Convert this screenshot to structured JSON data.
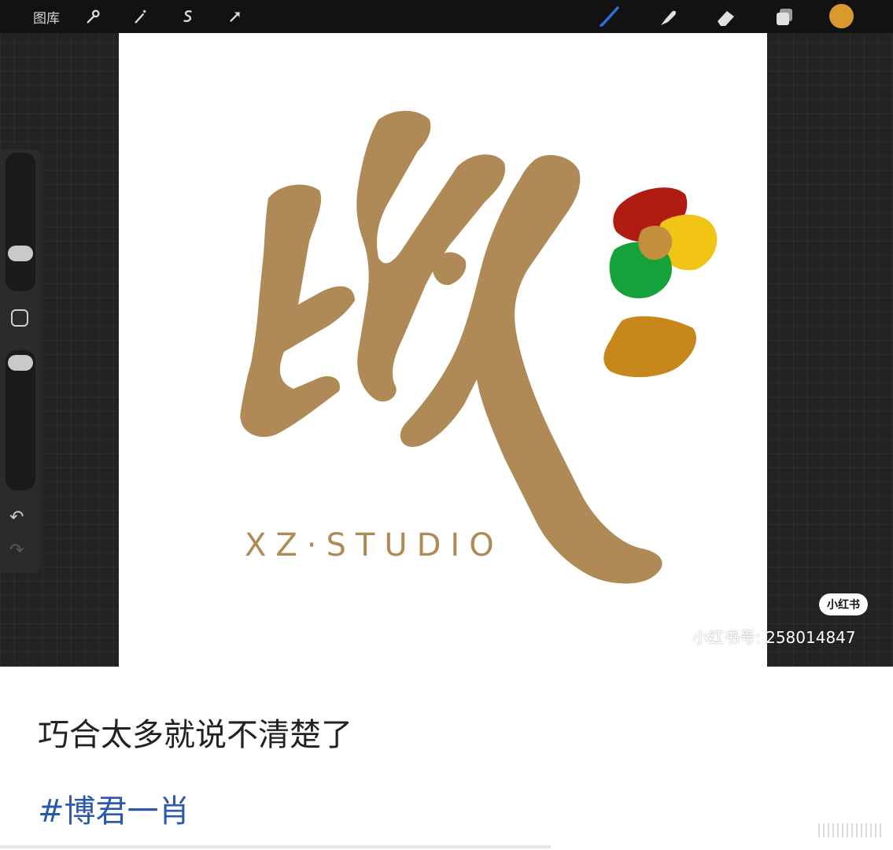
{
  "app": {
    "gallery_label": "图库",
    "colors": {
      "topbar_bg": "#121212",
      "canvas_bg": "#ffffff",
      "current_color": "#d89a2c",
      "brush_active": "#2f6fd6"
    },
    "left_tools": [
      "wrench-icon",
      "magic-wand-icon",
      "selection-icon",
      "transform-arrow-icon"
    ],
    "right_tools": [
      "brush-icon",
      "smudge-icon",
      "eraser-icon",
      "layers-icon",
      "color-picker-icon"
    ]
  },
  "canvas": {
    "logo_text": "XZ·STUDIO",
    "logo_color": "#b08a56",
    "watermark_badge": "小红书",
    "watermark_id": "小红书号: 258014847"
  },
  "post": {
    "caption": "巧合太多就说不清楚了",
    "hashtag": "#博君一肖"
  }
}
